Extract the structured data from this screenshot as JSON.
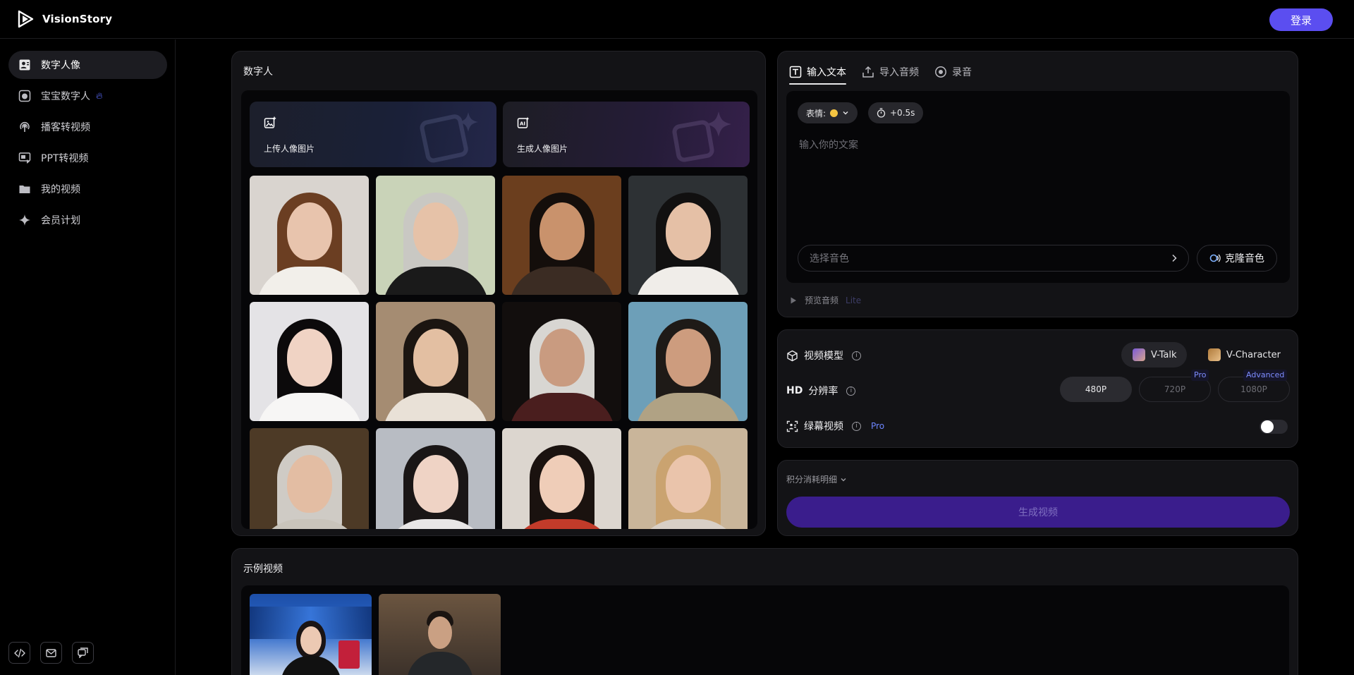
{
  "app": {
    "name": "VisionStory",
    "login_label": "登录"
  },
  "sidebar": {
    "items": [
      {
        "label": "数字人像",
        "icon": "person-card-icon",
        "active": true
      },
      {
        "label": "宝宝数字人",
        "icon": "baby-face-icon",
        "active": false,
        "badge_icon": "fire-icon"
      },
      {
        "label": "播客转视频",
        "icon": "podcast-icon",
        "active": false
      },
      {
        "label": "PPT转视频",
        "icon": "slides-icon",
        "active": false
      },
      {
        "label": "我的视频",
        "icon": "folder-icon",
        "active": false
      },
      {
        "label": "会员计划",
        "icon": "sparkle-icon",
        "active": false
      }
    ],
    "footer_icons": [
      "code-icon",
      "mail-icon",
      "feedback-icon"
    ]
  },
  "digital_person": {
    "title": "数字人",
    "upload_label": "上传人像图片",
    "generate_label": "生成人像图片",
    "portraits": [
      {
        "name": "portrait-1",
        "bg": "#d9d4cf",
        "skin": "#e8c4ad",
        "hair": "#6b3e22",
        "top": "#f2efea"
      },
      {
        "name": "portrait-2",
        "bg": "#c9d3b8",
        "skin": "#e6c2a8",
        "hair": "#c9c8c3",
        "top": "#1a1a1a"
      },
      {
        "name": "portrait-3",
        "bg": "#6b3e1e",
        "skin": "#c9926c",
        "hair": "#140e0b",
        "top": "#3b2c23"
      },
      {
        "name": "portrait-4",
        "bg": "#2d3134",
        "skin": "#e5c0a6",
        "hair": "#111010",
        "top": "#f0ede9"
      },
      {
        "name": "portrait-5",
        "bg": "#e4e3e6",
        "skin": "#f0d3c4",
        "hair": "#0c0a0b",
        "top": "#f7f6f5"
      },
      {
        "name": "portrait-6",
        "bg": "#a58c72",
        "skin": "#e3bfa2",
        "hair": "#1b1511",
        "top": "#e9e1d7"
      },
      {
        "name": "portrait-7",
        "bg": "#120e0d",
        "skin": "#c99b80",
        "hair": "#d8d6d2",
        "top": "#4a1e1e"
      },
      {
        "name": "portrait-8",
        "bg": "#6d9fb8",
        "skin": "#cd9c7e",
        "hair": "#1e1a17",
        "top": "#b0a284"
      },
      {
        "name": "portrait-9",
        "bg": "#4d3a26",
        "skin": "#e3bda3",
        "hair": "#cfcbc5",
        "top": "#c9c4bb"
      },
      {
        "name": "portrait-10",
        "bg": "#b8bcc3",
        "skin": "#efd3c5",
        "hair": "#1a1616",
        "top": "#e8e6e6"
      },
      {
        "name": "portrait-11",
        "bg": "#dcd6cf",
        "skin": "#efcdb8",
        "hair": "#1a120f",
        "top": "#c23b2a"
      },
      {
        "name": "portrait-12",
        "bg": "#c9b59a",
        "skin": "#eac4ab",
        "hair": "#caa370",
        "top": "#d8cfc6"
      }
    ]
  },
  "text_input": {
    "tabs": [
      {
        "label": "输入文本",
        "icon": "text-icon",
        "active": true
      },
      {
        "label": "导入音频",
        "icon": "upload-icon",
        "active": false
      },
      {
        "label": "录音",
        "icon": "record-icon",
        "active": false
      }
    ],
    "expression_label": "表情:",
    "pause_label": "+0.5s",
    "placeholder": "输入你的文案",
    "voice_placeholder": "选择音色",
    "clone_label": "克隆音色",
    "preview_label": "预览音频",
    "preview_tag": "Lite"
  },
  "settings": {
    "model_label": "视频模型",
    "models": [
      {
        "label": "V-Talk",
        "active": true
      },
      {
        "label": "V-Character",
        "active": false
      }
    ],
    "resolution_label": "分辨率",
    "hd_label": "HD",
    "resolutions": [
      {
        "label": "480P",
        "active": true,
        "tag": ""
      },
      {
        "label": "720P",
        "active": false,
        "tag": "Pro"
      },
      {
        "label": "1080P",
        "active": false,
        "tag": "Advanced"
      }
    ],
    "green_screen_label": "绿幕视频",
    "green_screen_tag": "Pro",
    "green_screen_on": false
  },
  "generate": {
    "credit_label": "积分消耗明细",
    "button_label": "生成视频"
  },
  "examples": {
    "title": "示例视频",
    "thumbs": [
      {
        "name": "example-news-anchor"
      },
      {
        "name": "example-presenter"
      }
    ]
  },
  "colors": {
    "accent": "#5b4ef0",
    "generate": "#3a1d8c",
    "pro": "#6d86ff"
  }
}
